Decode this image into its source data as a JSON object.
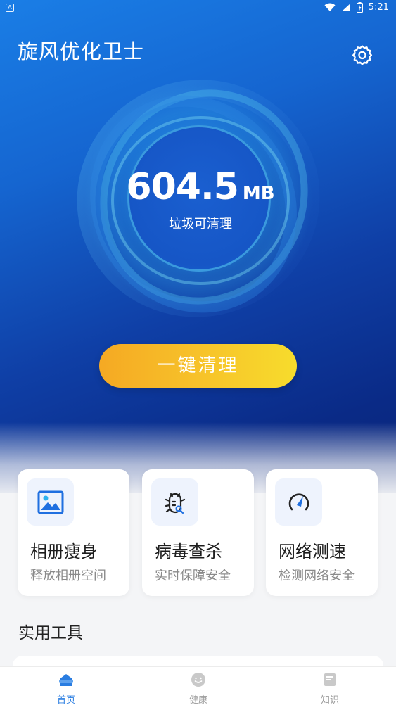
{
  "status_bar": {
    "left_icon_letter": "A",
    "time": "5:21",
    "icons": [
      "wifi-icon",
      "signal-icon",
      "battery-icon"
    ]
  },
  "header": {
    "title": "旋风优化卫士",
    "settings_icon": "gear-icon"
  },
  "cleanup": {
    "junk_size": "604.5",
    "junk_unit": "MB",
    "caption": "垃圾可清理",
    "button_label": "一键清理"
  },
  "features": [
    {
      "icon": "image-icon",
      "title": "相册瘦身",
      "subtitle": "释放相册空间"
    },
    {
      "icon": "bug-icon",
      "title": "病毒查杀",
      "subtitle": "实时保障安全"
    },
    {
      "icon": "speedometer-icon",
      "title": "网络测速",
      "subtitle": "检测网络安全"
    }
  ],
  "tools_section": {
    "title": "实用工具"
  },
  "tabbar": {
    "tabs": [
      {
        "label": "首页",
        "icon": "home-icon",
        "active": true
      },
      {
        "label": "健康",
        "icon": "smile-icon",
        "active": false
      },
      {
        "label": "知识",
        "icon": "book-icon",
        "active": false
      }
    ]
  },
  "colors": {
    "accent": "#2a7de1",
    "button_start": "#f5a923",
    "button_end": "#f7dc2c",
    "hero_top": "#1a7ee6",
    "hero_bottom": "#0a2578"
  }
}
